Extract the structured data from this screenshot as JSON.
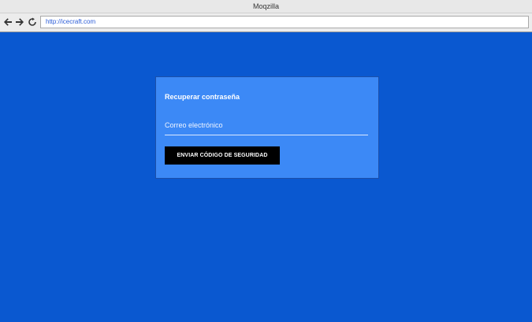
{
  "window": {
    "title": "Moqzilla"
  },
  "browser": {
    "back_icon": "arrow-left",
    "forward_icon": "arrow-right",
    "reload_icon": "reload",
    "url": "http://icecraft.com"
  },
  "colors": {
    "page_background": "#0a58d0",
    "card_background": "#3c89f6",
    "button_background": "#000000",
    "text": "#ffffff"
  },
  "recover_form": {
    "title": "Recuperar contraseña",
    "email_placeholder": "Correo electrónico",
    "email_value": "",
    "submit_label": "ENVIAR CÓDIGO DE SEGURIDAD"
  }
}
